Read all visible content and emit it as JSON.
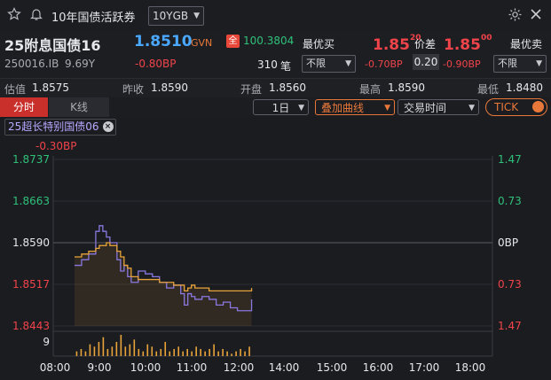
{
  "titlebar": {
    "title": "10年国债活跃券",
    "dropdown_value": "10YGB"
  },
  "quote": {
    "name": "25附息国债16",
    "code": "250016.IB",
    "term": "9.69Y",
    "price": "1.8510",
    "venue": "GVN",
    "change_bp": "-0.80BP",
    "full_badge": "全",
    "full_price": "100.3804",
    "volume": "310",
    "volume_unit": "笔",
    "best_buy_label": "最优买",
    "best_buy_select": "不限",
    "best_buy_price_main": "1.85",
    "best_buy_price_sup": "20",
    "best_buy_change": "-0.70BP",
    "spread_label": "价差",
    "spread_value": "0.20",
    "best_sell_label": "最优卖",
    "best_sell_select": "不限",
    "best_sell_price_main": "1.85",
    "best_sell_price_sup": "00",
    "best_sell_change": "-0.90BP"
  },
  "stats": [
    {
      "label": "估值",
      "value": "1.8575"
    },
    {
      "label": "昨收",
      "value": "1.8590"
    },
    {
      "label": "开盘",
      "value": "1.8560"
    },
    {
      "label": "最高",
      "value": "1.8590"
    },
    {
      "label": "最低",
      "value": "1.8480"
    }
  ],
  "tabs": {
    "tab_timeshare": "分时",
    "tab_kline": "K线",
    "period": "1日",
    "overlay": "叠加曲线",
    "trade_time": "交易时间",
    "tick": "TICK"
  },
  "legend": {
    "overlay_name": "25超长特别国债06",
    "overlay_change": "-0.30BP"
  },
  "colors": {
    "up": "#f0444a",
    "down": "#2fc07a",
    "price_line": "#e8a33a",
    "overlay_line": "#8a78e0",
    "accent": "#e8783a"
  },
  "chart_data": {
    "type": "line",
    "x_ticks": [
      "08:00",
      "9:00",
      "10:00",
      "11:00",
      "12:00",
      "14:00",
      "15:00",
      "16:00",
      "17:00",
      "18:00"
    ],
    "y_left_ticks": [
      "1.8737",
      "1.8663",
      "1.8590",
      "1.8517",
      "1.8443"
    ],
    "y_right_ticks": [
      "1.47",
      "0.73",
      "0BP",
      "0.73",
      "1.47"
    ],
    "ylim": [
      1.8443,
      1.8737
    ],
    "volume_tick": "9",
    "series": [
      {
        "x": [
          "08:30",
          "08:40",
          "08:50",
          "09:00",
          "09:05",
          "09:10",
          "09:15",
          "09:20",
          "09:30",
          "09:35",
          "09:40",
          "09:45",
          "09:50",
          "10:00",
          "10:10",
          "10:20",
          "10:30",
          "10:40",
          "10:50",
          "11:00",
          "11:05",
          "11:10",
          "11:15",
          "11:20",
          "11:30",
          "11:40",
          "11:50",
          "12:00",
          "12:10",
          "12:20",
          "12:30",
          "12:40"
        ],
        "values": [
          1.8565,
          1.857,
          1.8575,
          1.858,
          1.8585,
          1.8585,
          1.859,
          1.8585,
          1.8575,
          1.8565,
          1.855,
          1.8545,
          1.853,
          1.8525,
          1.8525,
          1.8525,
          1.852,
          1.852,
          1.8515,
          1.8515,
          1.8505,
          1.851,
          1.8515,
          1.851,
          1.851,
          1.8505,
          1.8505,
          1.8505,
          1.8505,
          1.8505,
          1.8505,
          1.851
        ]
      },
      {
        "x": [
          "08:30",
          "08:40",
          "08:50",
          "09:00",
          "09:05",
          "09:10",
          "09:15",
          "09:20",
          "09:30",
          "09:35",
          "09:40",
          "09:45",
          "09:50",
          "10:00",
          "10:10",
          "10:20",
          "10:30",
          "10:40",
          "10:50",
          "11:00",
          "11:05",
          "11:10",
          "11:15",
          "11:20",
          "11:30",
          "11:40",
          "11:50",
          "12:00",
          "12:10",
          "12:20",
          "12:30",
          "12:40"
        ],
        "values": [
          1.855,
          1.856,
          1.857,
          1.861,
          1.862,
          1.861,
          1.86,
          1.859,
          1.856,
          1.854,
          1.855,
          1.853,
          1.852,
          1.854,
          1.8535,
          1.853,
          1.852,
          1.851,
          1.8515,
          1.85,
          1.848,
          1.85,
          1.8495,
          1.849,
          1.8495,
          1.849,
          1.848,
          1.8485,
          1.8475,
          1.847,
          1.847,
          1.849
        ]
      }
    ],
    "volume": [
      2,
      3,
      2,
      5,
      4,
      6,
      8,
      3,
      4,
      6,
      9,
      4,
      5,
      7,
      3,
      2,
      5,
      4,
      2,
      3,
      6,
      2,
      3,
      4,
      2,
      3,
      2,
      4,
      3,
      2,
      3,
      5,
      2,
      3,
      2,
      1,
      2,
      3,
      2,
      4
    ]
  }
}
